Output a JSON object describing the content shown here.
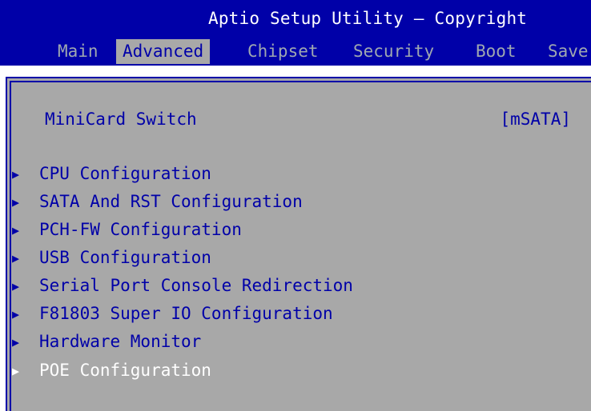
{
  "header": {
    "title": "Aptio Setup Utility – Copyright",
    "tabs": [
      "Main",
      "Advanced",
      "Chipset",
      "Security",
      "Boot",
      "Save"
    ]
  },
  "panel": {
    "setting": {
      "label": "MiniCard Switch",
      "value": "[mSATA]"
    },
    "arrow_glyph": "▶",
    "items": [
      "CPU Configuration",
      "SATA And RST Configuration",
      "PCH-FW Configuration",
      "USB Configuration",
      "Serial Port Console Redirection",
      "F81803 Super IO Configuration",
      "Hardware Monitor",
      "POE Configuration"
    ]
  },
  "colors": {
    "header_bg": "#0000a8",
    "panel_bg": "#a8a8a8",
    "text": "#0000a8",
    "highlight_text": "#ffffff"
  }
}
